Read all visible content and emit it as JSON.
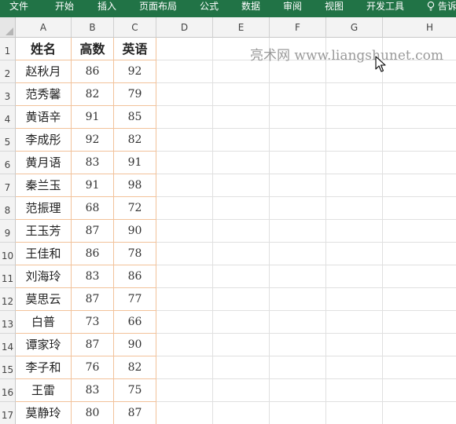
{
  "ribbon": {
    "tabs": [
      "文件",
      "开始",
      "插入",
      "页面布局",
      "公式",
      "数据",
      "审阅",
      "视图",
      "开发工具"
    ],
    "tell_me": "告诉",
    "bg_color": "#217346"
  },
  "sheet": {
    "columns": [
      "A",
      "B",
      "C",
      "D",
      "E",
      "F",
      "G",
      "H"
    ],
    "rows": [
      "1",
      "2",
      "3",
      "4",
      "5",
      "6",
      "7",
      "8",
      "9",
      "10",
      "11",
      "12",
      "13",
      "14",
      "15",
      "16",
      "17"
    ],
    "header": [
      "姓名",
      "高数",
      "英语"
    ],
    "records": [
      [
        "赵秋月",
        "86",
        "92"
      ],
      [
        "范秀馨",
        "82",
        "79"
      ],
      [
        "黄语辛",
        "91",
        "85"
      ],
      [
        "李成彤",
        "92",
        "82"
      ],
      [
        "黄月语",
        "83",
        "91"
      ],
      [
        "秦兰玉",
        "91",
        "98"
      ],
      [
        "范振理",
        "68",
        "72"
      ],
      [
        "王玉芳",
        "87",
        "90"
      ],
      [
        "王佳和",
        "86",
        "78"
      ],
      [
        "刘海玲",
        "83",
        "86"
      ],
      [
        "莫思云",
        "87",
        "77"
      ],
      [
        "白普",
        "73",
        "66"
      ],
      [
        "谭家玲",
        "87",
        "90"
      ],
      [
        "李子和",
        "76",
        "82"
      ],
      [
        "王雷",
        "83",
        "75"
      ],
      [
        "莫静玲",
        "80",
        "87"
      ]
    ],
    "data_border_color": "#f2c29a"
  },
  "watermark": "亮术网 www.liangshunet.com",
  "icons": {
    "cursor": "mouse-pointer-icon",
    "tell_me": "lightbulb-icon",
    "corner": "select-all-triangle-icon"
  }
}
